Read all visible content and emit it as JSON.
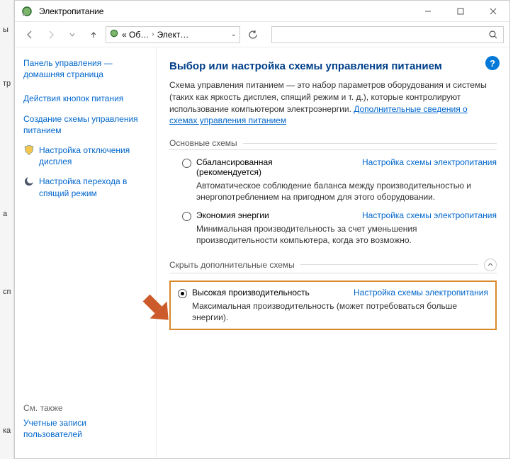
{
  "window": {
    "title": "Электропитание"
  },
  "nav": {
    "crumb1": "« Об…",
    "crumb2": "Элект…"
  },
  "sidebar": {
    "home1": "Панель управления —",
    "home2": "домашняя страница",
    "link1": "Действия кнопок питания",
    "link2a": "Создание схемы управления",
    "link2b": "питанием",
    "link3a": "Настройка отключения",
    "link3b": "дисплея",
    "link4a": "Настройка перехода в",
    "link4b": "спящий режим",
    "see_also_hd": "См. также",
    "see_also1a": "Учетные записи",
    "see_also1b": "пользователей"
  },
  "main": {
    "title": "Выбор или настройка схемы управления питанием",
    "desc_part1": "Схема управления питанием — это набор параметров оборудования и системы (таких как яркость дисплея, спящий режим и т. д.), которые контролируют использование компьютером электроэнергии. ",
    "desc_link": "Дополнительные сведения о схемах управления питанием",
    "group1": "Основные схемы",
    "group2": "Скрыть дополнительные схемы",
    "config_link": "Настройка схемы электропитания"
  },
  "schemes": {
    "balanced": {
      "name": "Сбалансированная",
      "rec": "(рекомендуется)",
      "desc": "Автоматическое соблюдение баланса между производительностью и энергопотреблением на пригодном для этого оборудовании."
    },
    "saver": {
      "name": "Экономия энергии",
      "desc": "Минимальная производительность за счет уменьшения производительности компьютера, когда это возможно."
    },
    "high": {
      "name": "Высокая производительность",
      "desc": "Максимальная производительность (может потребоваться больше энергии)."
    }
  },
  "bg": {
    "a": "ы",
    "b": "тр",
    "c": "а",
    "d": "сп",
    "e": "ка"
  }
}
